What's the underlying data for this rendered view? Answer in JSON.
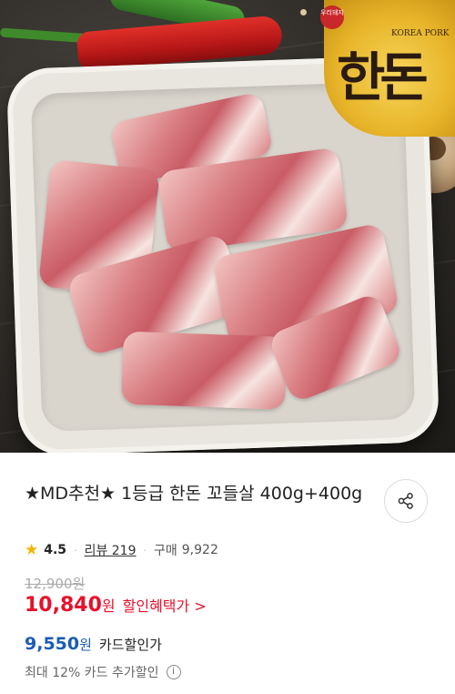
{
  "product": {
    "title": "★MD추천★ 1등급 한돈 꼬들살 400g+400g",
    "rating": "4.5",
    "review_label": "리뷰 219",
    "purchase_label": "구매",
    "purchase_count": "9,922"
  },
  "price": {
    "original": "12,900원",
    "sale": "10,840",
    "sale_unit": "원",
    "sale_link": "할인혜택가 >",
    "card": "9,550",
    "card_unit": "원",
    "card_label": "카드할인가",
    "extra": "최대 12% 카드 추가할인"
  },
  "logo": {
    "mark": "한돈",
    "text": "KOREA PORK",
    "badge": "우리돼지"
  },
  "icons": {
    "share": "share-icon",
    "star": "star-icon",
    "info": "info-icon"
  },
  "colors": {
    "sale_red": "#e8102a",
    "card_blue": "#1b5bb3",
    "star_yellow": "#f5b301"
  }
}
